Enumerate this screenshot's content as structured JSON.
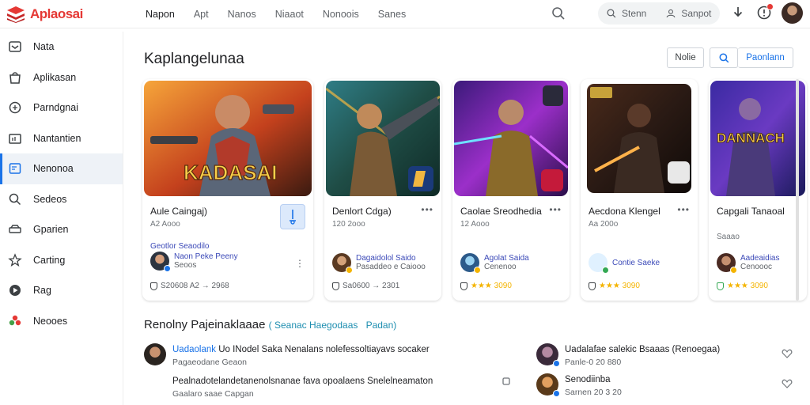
{
  "brand": {
    "name": "Aplaosai",
    "color": "#e53935"
  },
  "nav": [
    "Napon",
    "Apt",
    "Nanos",
    "Niaaot",
    "Nonoois",
    "Sanes"
  ],
  "header": {
    "search_pill": "Stenn",
    "signin_pill": "Sanpot"
  },
  "sidebar": {
    "active_index": 4,
    "items": [
      {
        "label": "Nata",
        "icon": "inbox-icon"
      },
      {
        "label": "Aplikasan",
        "icon": "bag-icon"
      },
      {
        "label": "Parndgnai",
        "icon": "gamepad-icon"
      },
      {
        "label": "Nantantien",
        "icon": "tv-icon"
      },
      {
        "label": "Nenonoa",
        "icon": "bookmark-icon"
      },
      {
        "label": "Sedeos",
        "icon": "search-icon"
      },
      {
        "label": "Gparien",
        "icon": "car-icon"
      },
      {
        "label": "Carting",
        "icon": "star-icon"
      },
      {
        "label": "Rag",
        "icon": "play-icon"
      },
      {
        "label": "Neooes",
        "icon": "flower-icon"
      }
    ]
  },
  "main": {
    "title": "Kaplangelunaa",
    "buttons": {
      "news": "Nolie",
      "primary": "Paonlann"
    },
    "cards": [
      {
        "title": "Aule Caingaj)",
        "meta": "A2 Aooo",
        "dev_link": "Geotlor Seaodilo",
        "dev_name": "Naon Peke Peeny",
        "dev_sub": "Seoos",
        "rating": "S20608 A2 → 2968",
        "art_text": "KADASAI"
      },
      {
        "title": "Denlort Cdga)",
        "meta": "120 2ooo",
        "dev_link": "",
        "dev_name": "Dagaidolol Saido",
        "dev_sub": "Pasaddeo e Caiooo",
        "rating": "Sa0600 → 2301",
        "art_text": ""
      },
      {
        "title": "Caolae Sreodhedia",
        "meta": "12 Aooo",
        "dev_link": "",
        "dev_name": "Agolat Saida",
        "dev_sub": "Cenenoo",
        "rating": "★★★ 3090",
        "art_text": ""
      },
      {
        "title": "Aecdona Klengel",
        "meta": "Aa 200o",
        "dev_link": "",
        "dev_name": "Contie Saeke",
        "dev_sub": "",
        "rating": "★★★ 3090",
        "art_text": ""
      },
      {
        "title": "Capgali Tanaoal",
        "meta": "Saaao",
        "dev_link": "",
        "dev_name": "Aadeaidias",
        "dev_sub": "Cenoooc",
        "rating": "★★★ 3090",
        "art_text": "DANNACH"
      }
    ]
  },
  "reviews": {
    "title": "Renolny Pajeinaklaaae",
    "accent_a": "Seanac Haegodaas",
    "accent_b": "Padan)",
    "left": [
      {
        "line1_hl": "Uadaolank",
        "line1": "Uo INodel Saka Nenalans nolefessoltiayavs socaker",
        "line2": "Pagaeodane Geaon"
      },
      {
        "line1_hl": "",
        "line1": "Pealnadotelandetanenolsnanae fava opoalaens Snelelneamaton",
        "line2": "Gaalaro saae Capgan"
      }
    ],
    "right": [
      {
        "line1": "Uadalafae salekic Bsaaas (Renoegaa)",
        "line2": "Panle-0 20 880"
      },
      {
        "line1": "Senodiinba",
        "line2": "Sarnen 20 3 20"
      }
    ]
  }
}
